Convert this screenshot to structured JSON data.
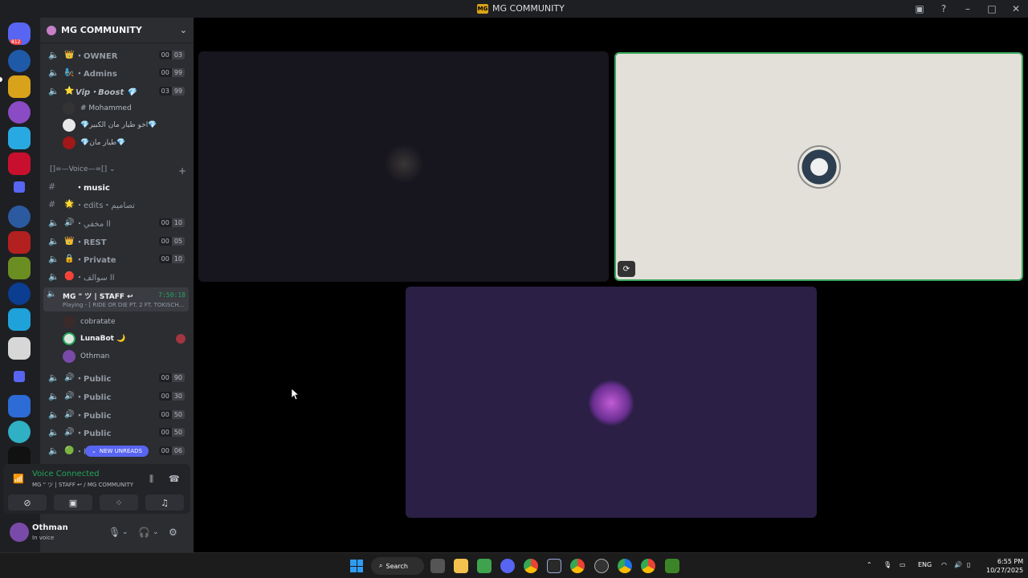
{
  "window": {
    "title": "MG COMMUNITY",
    "logo_text": "MG"
  },
  "server_badge": "812",
  "guild": {
    "name": "MG COMMUNITY"
  },
  "channels": [
    {
      "emoji": "👑",
      "name": "・OWNER",
      "c1": "00",
      "c2": "03"
    },
    {
      "emoji": "🧞",
      "name": "・Admins",
      "c1": "00",
      "c2": "99"
    },
    {
      "emoji": "⭐",
      "name": "Vip・Boost 💎",
      "c1": "03",
      "c2": "99"
    }
  ],
  "vip_users": [
    {
      "name": "# Mohammed"
    },
    {
      "name": "💎اخو طيار مان الكبير💎"
    },
    {
      "name": "💎طيار مان💎"
    }
  ],
  "category": {
    "name": "[]=—Voice—=[]",
    "plus": "+"
  },
  "text_channels": [
    {
      "emoji": "",
      "name": "・music"
    },
    {
      "emoji": "🌟",
      "name": "・edits・تصاميم"
    }
  ],
  "channels2": [
    {
      "emoji": "🔊",
      "name": "・مخفي ll",
      "c1": "00",
      "c2": "10"
    },
    {
      "emoji": "👑",
      "name": "・REST",
      "c1": "00",
      "c2": "05"
    },
    {
      "emoji": "🔒",
      "name": "・Private",
      "c1": "00",
      "c2": "10"
    },
    {
      "emoji": "🛑",
      "name": "・سوالف ll",
      "c1": "",
      "c2": ""
    }
  ],
  "active_channel": {
    "name": "MG \" ツ | STAFF ↩",
    "time": "7:50:18",
    "activity": "Playing - [ RIDE OR DIE PT. 2 FT. TOKISCH..."
  },
  "staff_users": [
    {
      "name": "cobratate"
    },
    {
      "name": "LunaBot 🌙"
    },
    {
      "name": "Othman"
    }
  ],
  "public_channels": [
    {
      "name": "・Public",
      "c1": "00",
      "c2": "90"
    },
    {
      "name": "・Public",
      "c1": "00",
      "c2": "30"
    },
    {
      "name": "・Public",
      "c1": "00",
      "c2": "50"
    },
    {
      "name": "・Public",
      "c1": "00",
      "c2": "50"
    },
    {
      "name": "・l",
      "c1": "00",
      "c2": "06"
    }
  ],
  "new_unreads": "NEW UNREADS",
  "voice": {
    "status": "Voice Connected",
    "channel": "MG \" ツ | STAFF ↩ / MG COMMUNITY"
  },
  "user": {
    "name": "Othman",
    "status": "In voice"
  },
  "taskbar": {
    "search_label": "Search",
    "lang": "ENG",
    "time": "6:55 PM",
    "date": "10/27/2025"
  },
  "colors": {
    "accent": "#5865f2",
    "online": "#23a55a",
    "speaking": "#3ba55c"
  }
}
